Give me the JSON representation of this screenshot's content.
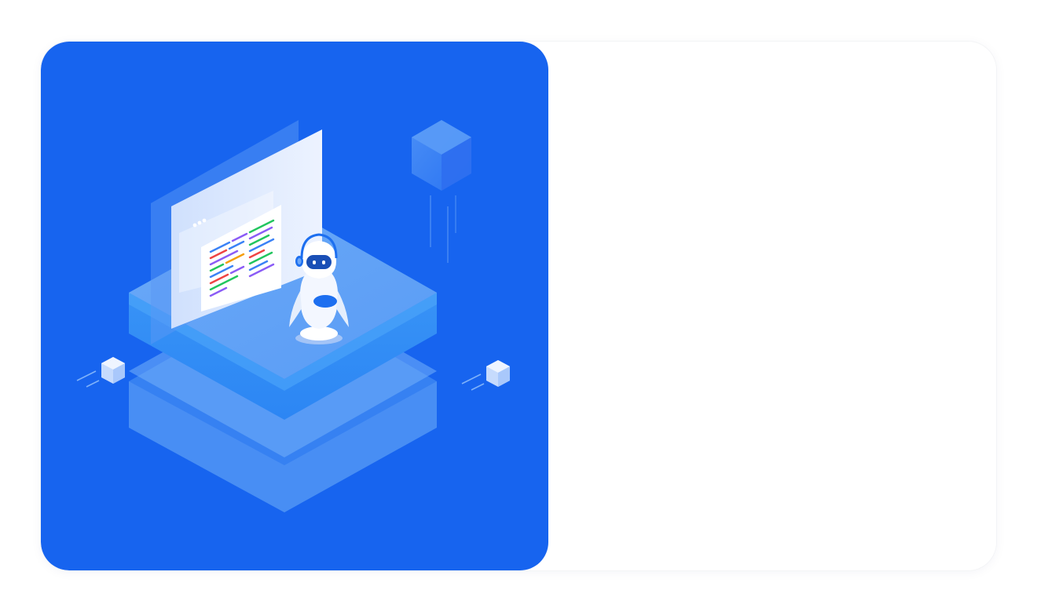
{
  "theme": {
    "accent": "#1764ef",
    "background": "#ffffff"
  },
  "hero": {
    "illustration": "robot-customer-service-platform",
    "icons": [
      "robot-icon",
      "headset-icon",
      "browser-window-icon",
      "code-document-icon",
      "cube-icon"
    ]
  },
  "form_panel": {
    "state": "empty"
  }
}
